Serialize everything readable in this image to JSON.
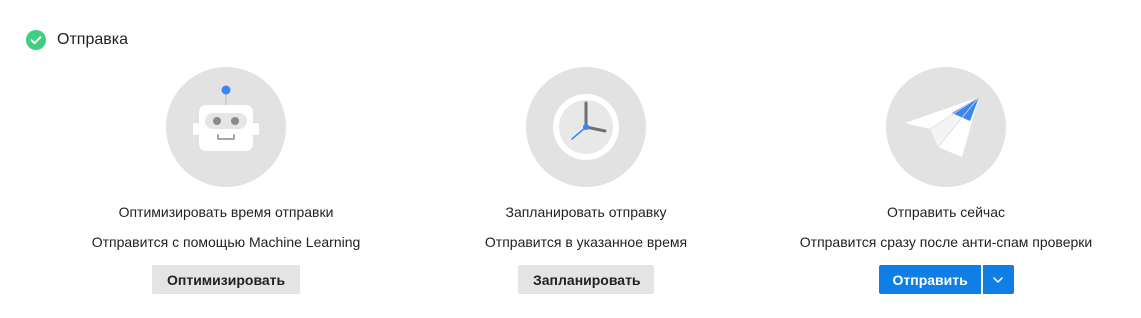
{
  "section": {
    "title": "Отправка",
    "status_icon": "check-circle-icon",
    "status_color": "#3ccf7f"
  },
  "options": [
    {
      "illustration": "robot-icon",
      "title": "Оптимизировать время отправки",
      "description": "Отправится с помощью Machine Learning",
      "button_label": "Оптимизировать"
    },
    {
      "illustration": "clock-icon",
      "title": "Запланировать отправку",
      "description": "Отправится в указанное время",
      "button_label": "Запланировать"
    },
    {
      "illustration": "paper-plane-icon",
      "title": "Отправить сейчас",
      "description": "Отправится сразу после анти-спам проверки",
      "button_label": "Отправить",
      "dropdown_icon": "chevron-down-icon"
    }
  ],
  "colors": {
    "accent": "#0f7fe6",
    "illustration_bg": "#e2e2e2",
    "secondary_button_bg": "#e4e4e4"
  }
}
